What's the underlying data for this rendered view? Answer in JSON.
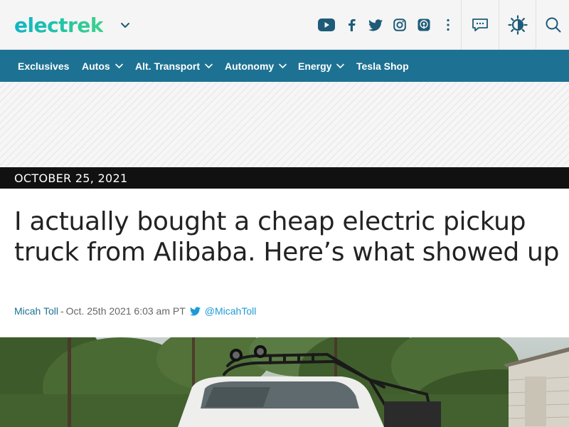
{
  "header": {
    "logo_text": "electrek",
    "icons": [
      "youtube-icon",
      "facebook-icon",
      "twitter-icon",
      "instagram-icon",
      "podcast-icon",
      "more-vertical-icon",
      "comments-icon",
      "theme-toggle-icon",
      "search-icon"
    ]
  },
  "nav": {
    "items": [
      {
        "label": "Exclusives",
        "has_dropdown": false
      },
      {
        "label": "Autos",
        "has_dropdown": true
      },
      {
        "label": "Alt. Transport",
        "has_dropdown": true
      },
      {
        "label": "Autonomy",
        "has_dropdown": true
      },
      {
        "label": "Energy",
        "has_dropdown": true
      },
      {
        "label": "Tesla Shop",
        "has_dropdown": false
      }
    ]
  },
  "article": {
    "date": "OCTOBER 25, 2021",
    "title": "I actually bought a cheap electric pickup truck from Alibaba. Here’s what showed up",
    "author": "Micah Toll",
    "separator": "-",
    "timestamp": "Oct. 25th 2021 6:03 am PT",
    "twitter_handle": "@MicahToll"
  },
  "colors": {
    "nav_bg": "#1d7293",
    "date_bar_bg": "#111111",
    "author_link": "#1d7293",
    "twitter_link": "#1d9bd6",
    "logo_gradient": [
      "#12b4c7",
      "#3fd18a"
    ]
  }
}
